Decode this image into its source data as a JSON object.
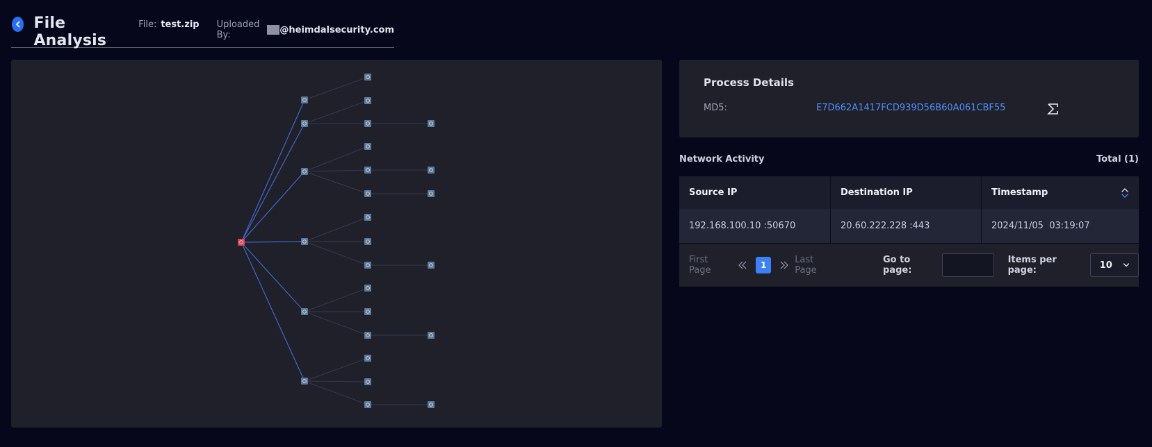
{
  "header": {
    "title": "File Analysis",
    "file_label": "File:",
    "file_name": "test.zip",
    "uploaded_label": "Uploaded By:",
    "uploader_domain": "@heimdalsecurity.com"
  },
  "process_details": {
    "title": "Process Details",
    "md5_label": "MD5:",
    "md5_value": "E7D662A1417FCD939D56B60A061CBF55"
  },
  "network_activity": {
    "title": "Network Activity",
    "total": "Total (1)",
    "columns": [
      "Source IP",
      "Destination IP",
      "Timestamp"
    ],
    "rows": [
      {
        "source": "192.168.100.10 :50670",
        "destination": "20.60.222.228 :443",
        "timestamp": "2024/11/05  03:19:07"
      }
    ]
  },
  "pagination": {
    "first": "First Page",
    "current": "1",
    "last": "Last Page",
    "goto_label": "Go to page:",
    "goto_value": "",
    "items_label": "Items per page:",
    "items_value": "10"
  },
  "colors": {
    "accent": "#3c82f6",
    "root_node": "#e0404d",
    "child_node": "#5f7a99",
    "link_value": "#4f8ff7"
  },
  "icons": {
    "back": "chevron-left-icon",
    "sigma": "sigma-icon",
    "sort": "sort-icon",
    "prev": "double-chevron-left-icon",
    "next": "double-chevron-right-icon",
    "dropdown": "chevron-down-icon"
  }
}
